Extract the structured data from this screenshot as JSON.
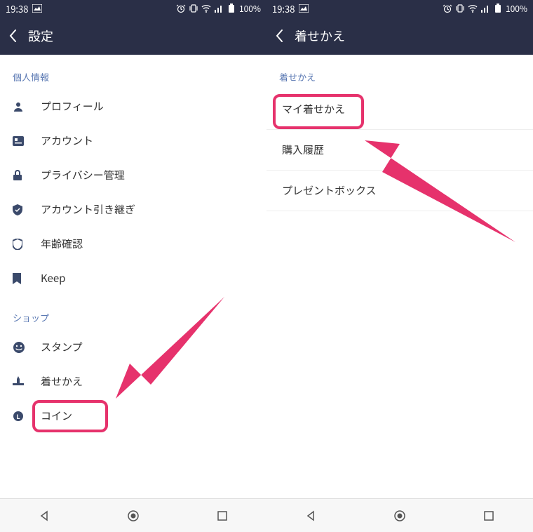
{
  "status": {
    "time": "19:38",
    "battery": "100%"
  },
  "left": {
    "header_title": "設定",
    "section1_title": "個人情報",
    "section1_items": [
      {
        "label": "プロフィール"
      },
      {
        "label": "アカウント"
      },
      {
        "label": "プライバシー管理"
      },
      {
        "label": "アカウント引き継ぎ"
      },
      {
        "label": "年齢確認"
      },
      {
        "label": "Keep"
      }
    ],
    "section2_title": "ショップ",
    "section2_items": [
      {
        "label": "スタンプ"
      },
      {
        "label": "着せかえ"
      },
      {
        "label": "コイン"
      }
    ]
  },
  "right": {
    "header_title": "着せかえ",
    "section_title": "着せかえ",
    "items": [
      {
        "label": "マイ着せかえ"
      },
      {
        "label": "購入履歴"
      },
      {
        "label": "プレゼントボックス"
      }
    ]
  },
  "highlight_color": "#e6326c"
}
